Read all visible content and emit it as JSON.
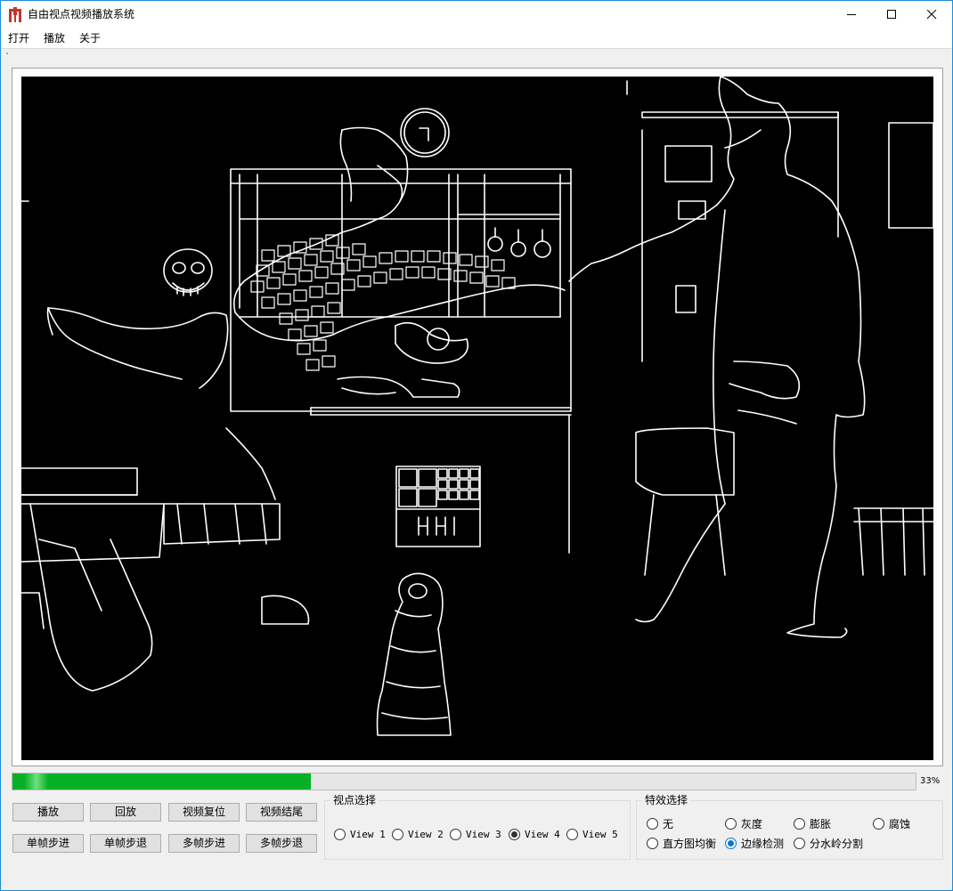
{
  "window": {
    "title": "自由视点视频播放系统",
    "icon": "app-logo-icon",
    "accent_color": "#1f8cd9"
  },
  "menu": {
    "items": [
      {
        "label": "打开"
      },
      {
        "label": "播放"
      },
      {
        "label": "关于"
      }
    ]
  },
  "video": {
    "frame_description_icon": "edge-detected-video-frame"
  },
  "progress": {
    "value_percent": 33,
    "text": "33%",
    "fill_color": "#06b025"
  },
  "buttons": {
    "row1": [
      {
        "label": "播放"
      },
      {
        "label": "回放"
      },
      {
        "label": "视频复位"
      },
      {
        "label": "视频结尾"
      }
    ],
    "row2": [
      {
        "label": "单帧步进"
      },
      {
        "label": "单帧步退"
      },
      {
        "label": "多帧步进"
      },
      {
        "label": "多帧步退"
      }
    ]
  },
  "view_select": {
    "title": "视点选择",
    "options": [
      {
        "label": "View 1",
        "checked": false
      },
      {
        "label": "View 2",
        "checked": false
      },
      {
        "label": "View 3",
        "checked": false
      },
      {
        "label": "View 4",
        "checked": true
      },
      {
        "label": "View 5",
        "checked": false
      }
    ]
  },
  "effect_select": {
    "title": "特效选择",
    "options": [
      {
        "label": "无",
        "checked": false
      },
      {
        "label": "灰度",
        "checked": false
      },
      {
        "label": "膨胀",
        "checked": false
      },
      {
        "label": "腐蚀",
        "checked": false
      },
      {
        "label": "直方图均衡",
        "checked": false
      },
      {
        "label": "边缘检测",
        "checked": true
      },
      {
        "label": "分水岭分割",
        "checked": false
      }
    ]
  }
}
